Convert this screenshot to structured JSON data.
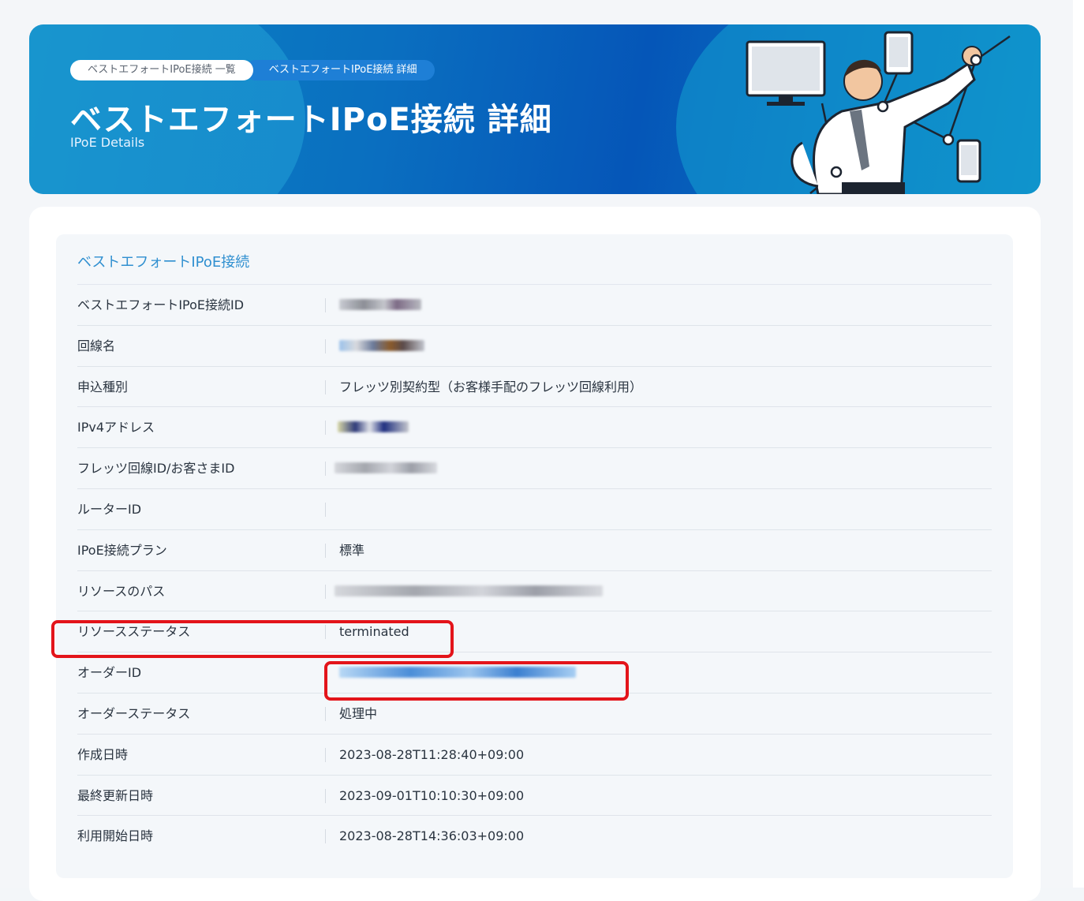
{
  "breadcrumb": {
    "items": [
      {
        "label": "ベストエフォートIPoE接続 一覧"
      },
      {
        "label": "ベストエフォートIPoE接続 詳細"
      }
    ]
  },
  "header": {
    "title": "ベストエフォートIPoE接続 詳細",
    "subtitle": "IPoE Details"
  },
  "section": {
    "title": "ベストエフォートIPoE接続"
  },
  "rows": [
    {
      "label": "ベストエフォートIPoE接続ID",
      "value": ""
    },
    {
      "label": "回線名",
      "value": ""
    },
    {
      "label": "申込種別",
      "value": "フレッツ別契約型（お客様手配のフレッツ回線利用）"
    },
    {
      "label": "IPv4アドレス",
      "value": ""
    },
    {
      "label": "フレッツ回線ID/お客さまID",
      "value": ""
    },
    {
      "label": "ルーターID",
      "value": ""
    },
    {
      "label": "IPoE接続プラン",
      "value": "標準"
    },
    {
      "label": "リソースのパス",
      "value": ""
    },
    {
      "label": "リソースステータス",
      "value": "terminated"
    },
    {
      "label": "オーダーID",
      "value": ""
    },
    {
      "label": "オーダーステータス",
      "value": "処理中"
    },
    {
      "label": "作成日時",
      "value": "2023-08-28T11:28:40+09:00"
    },
    {
      "label": "最終更新日時",
      "value": "2023-09-01T10:10:30+09:00"
    },
    {
      "label": "利用開始日時",
      "value": "2023-08-28T14:36:03+09:00"
    }
  ],
  "colors": {
    "accent": "#2f8fd0",
    "highlight": "#e3141a",
    "banner": "#0a6fc0"
  }
}
